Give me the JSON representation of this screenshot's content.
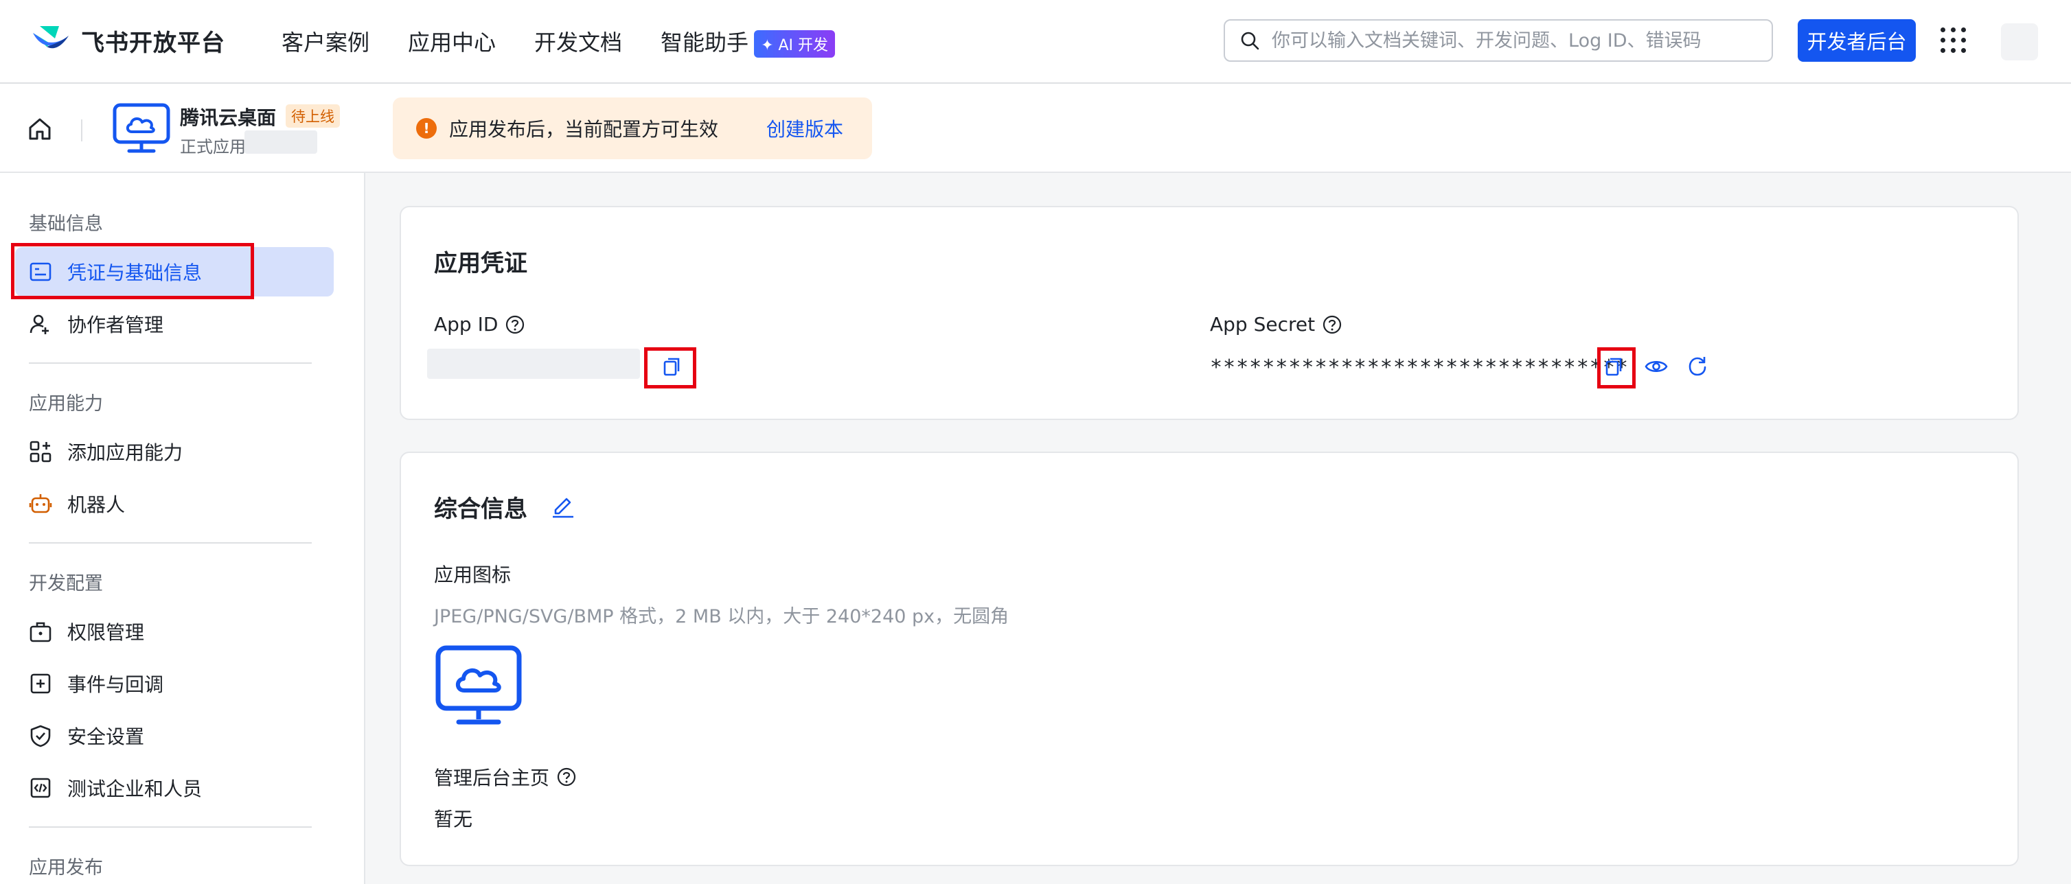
{
  "header": {
    "logo_text": "飞书开放平台",
    "nav": [
      "客户案例",
      "应用中心",
      "开发文档",
      "智能助手"
    ],
    "ai_badge": "✦ AI 开发",
    "search_placeholder": "你可以输入文档关键词、开发问题、Log ID、错误码",
    "dev_console": "开发者后台",
    "brand_color": "#1456f0"
  },
  "app_bar": {
    "app_name": "腾讯云桌面",
    "status": "待上线",
    "app_type": "正式应用",
    "notice_text": "应用发布后，当前配置方可生效",
    "notice_action": "创建版本"
  },
  "sidebar": {
    "sections": [
      {
        "title": "基础信息",
        "items": [
          {
            "label": "凭证与基础信息",
            "icon": "credential-icon",
            "active": true
          },
          {
            "label": "协作者管理",
            "icon": "user-add-icon"
          }
        ]
      },
      {
        "title": "应用能力",
        "items": [
          {
            "label": "添加应用能力",
            "icon": "apps-add-icon"
          },
          {
            "label": "机器人",
            "icon": "robot-icon"
          }
        ]
      },
      {
        "title": "开发配置",
        "items": [
          {
            "label": "权限管理",
            "icon": "lock-icon"
          },
          {
            "label": "事件与回调",
            "icon": "event-icon"
          },
          {
            "label": "安全设置",
            "icon": "shield-icon"
          },
          {
            "label": "测试企业和人员",
            "icon": "code-icon"
          }
        ]
      },
      {
        "title": "应用发布",
        "items": []
      }
    ]
  },
  "credentials": {
    "title": "应用凭证",
    "app_id_label": "App ID",
    "app_secret_label": "App Secret",
    "app_secret_masked": "********************************"
  },
  "general": {
    "title": "综合信息",
    "icon_label": "应用图标",
    "icon_hint": "JPEG/PNG/SVG/BMP 格式，2 MB 以内，大于 240*240 px，无圆角",
    "admin_home_label": "管理后台主页",
    "admin_home_value": "暂无"
  }
}
